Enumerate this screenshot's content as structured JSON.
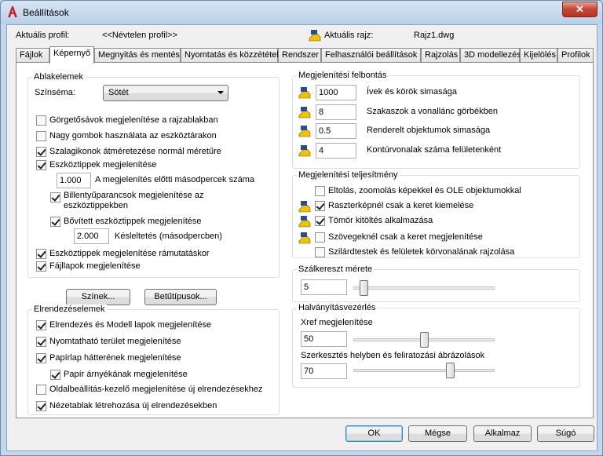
{
  "window": {
    "title": "Beállítások",
    "close": "✕"
  },
  "header": {
    "profile_label": "Aktuális profil:",
    "profile_value": "<<Névtelen profil>>",
    "drawing_label": "Aktuális rajz:",
    "drawing_value": "Rajz1.dwg"
  },
  "tabs": [
    {
      "label": "Fájlok"
    },
    {
      "label": "Képernyő"
    },
    {
      "label": "Megnyitás és mentés"
    },
    {
      "label": "Nyomtatás és közzététel"
    },
    {
      "label": "Rendszer"
    },
    {
      "label": "Felhasználói beállítások"
    },
    {
      "label": "Rajzolás"
    },
    {
      "label": "3D modellezés"
    },
    {
      "label": "Kijelölés"
    },
    {
      "label": "Profilok"
    }
  ],
  "window_elements": {
    "title": "Ablakelemek",
    "colorscheme_label": "Színséma:",
    "colorscheme_value": "Sötét",
    "options": [
      {
        "label": "Görgetősávok megjelenítése a rajzablakban",
        "checked": false
      },
      {
        "label": "Nagy gombok használata az eszköztárakon",
        "checked": false
      },
      {
        "label": "Szalagikonok átméretezése normál méretűre",
        "checked": true
      },
      {
        "label": "Eszköztippek megjelenítése",
        "checked": true
      }
    ],
    "tooltip_delay_value": "1.000",
    "tooltip_delay_label": "A megjelenítés előtti másodpercek száma",
    "shortcut_label": "Billentyűparancsok megjelenítése az eszköztippekben",
    "shortcut_checked": true,
    "extended_label": "Bővített eszköztippek megjelenítése",
    "extended_checked": true,
    "delay_value": "2.000",
    "delay_label": "Késleltetés (másodpercben)",
    "rollover_label": "Eszköztippek megjelenítése rámutatáskor",
    "rollover_checked": true,
    "filetabs_label": "Fájllapok megjelenítése",
    "filetabs_checked": true,
    "colors_button": "Színek...",
    "fonts_button": "Betűtípusok..."
  },
  "layout_elements": {
    "title": "Elrendezéselemek",
    "options": [
      {
        "label": "Elrendezés és Modell lapok megjelenítése",
        "checked": true
      },
      {
        "label": "Nyomtatható terület megjelenítése",
        "checked": true
      },
      {
        "label": "Papírlap hátterének megjelenítése",
        "checked": true
      }
    ],
    "shadow_label": "Papír árnyékának megjelenítése",
    "shadow_checked": true,
    "pagesetup_label": "Oldalbeállítás-kezelő megjelenítése új elrendezésekhez",
    "pagesetup_checked": false,
    "viewport_label": "Nézetablak létrehozása új elrendezésekben",
    "viewport_checked": true
  },
  "resolution": {
    "title": "Megjelenítési felbontás",
    "items": [
      {
        "value": "1000",
        "label": "Ívek és körök simasága"
      },
      {
        "value": "8",
        "label": "Szakaszok a vonallánc görbékben"
      },
      {
        "value": "0.5",
        "label": "Renderelt objektumok simasága"
      },
      {
        "value": "4",
        "label": "Kontúrvonalak száma felületenként"
      }
    ]
  },
  "performance": {
    "title": "Megjelenítési teljesítmény",
    "items": [
      {
        "label": "Eltolás, zoomolás képekkel és OLE objektumokkal",
        "checked": false,
        "icon": false
      },
      {
        "label": "Raszterképnél csak a keret kiemelése",
        "checked": true,
        "icon": true
      },
      {
        "label": "Tömör kitöltés alkalmazása",
        "checked": true,
        "icon": true
      },
      {
        "label": "Szövegeknél csak a keret megjelenítése",
        "checked": false,
        "icon": true
      },
      {
        "label": "Szilárdtestek és felületek körvonalának rajzolása",
        "checked": false,
        "icon": false
      }
    ]
  },
  "crosshair": {
    "title": "Szálkereszt mérete",
    "value": "5",
    "level": 5
  },
  "fade": {
    "title": "Halványításvezérlés",
    "xref_label": "Xref megjelenítése",
    "xref_value": "50",
    "xref_level": 50,
    "inplace_label": "Szerkesztés helyben és feliratozási ábrázolások",
    "inplace_value": "70",
    "inplace_level": 70
  },
  "footer": {
    "ok": "OK",
    "cancel": "Mégse",
    "apply": "Alkalmaz",
    "help": "Súgó"
  },
  "colors": {
    "accent": "#3c7fb1",
    "close": "#c7493a",
    "icon_red": "#c62828"
  }
}
